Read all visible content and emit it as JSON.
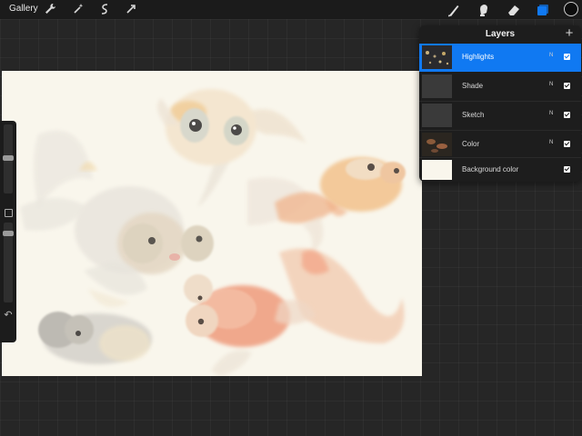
{
  "toolbar": {
    "gallery_label": "Gallery",
    "left_icons": [
      "wrench-icon",
      "magic-wand-icon",
      "selection-icon",
      "transform-icon"
    ],
    "right_icons": [
      "brush-icon",
      "smudge-icon",
      "eraser-icon",
      "layers-icon"
    ],
    "current_color": "#0d0d0d",
    "accent_color": "#1079f2"
  },
  "layers_panel": {
    "title": "Layers",
    "add_label": "+",
    "layers": [
      {
        "name": "Highlights",
        "blend": "N",
        "visible": true,
        "active": true
      },
      {
        "name": "Shade",
        "blend": "N",
        "visible": true,
        "active": false
      },
      {
        "name": "Sketch",
        "blend": "N",
        "visible": true,
        "active": false
      },
      {
        "name": "Color",
        "blend": "N",
        "visible": true,
        "active": false
      },
      {
        "name": "Background color",
        "blend": "",
        "visible": true,
        "active": false
      }
    ]
  },
  "sidebar": {
    "brush_size_level": 0.25,
    "opacity_level": 0.1,
    "undo_icon": "undo-icon"
  }
}
